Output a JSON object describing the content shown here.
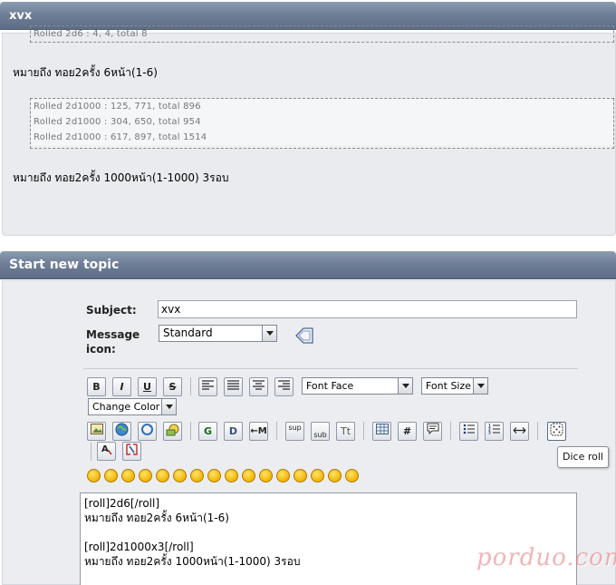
{
  "post": {
    "title": "xvx",
    "roll1": [
      "Rolled 2d6 : 4, 4, total 8"
    ],
    "line1": "หมายถึง ทอย2ครั้ง 6หน้า(1-6)",
    "roll2": [
      "Rolled 2d1000 : 125, 771, total 896",
      "Rolled 2d1000 : 304, 650, total 954",
      "Rolled 2d1000 : 617, 897, total 1514"
    ],
    "line2": "หมายถึง ทอย2ครั้ง 1000หน้า(1-1000) 3รอบ"
  },
  "form": {
    "title": "Start new topic",
    "subject_label": "Subject:",
    "subject_value": "xvx",
    "icon_label": "Message icon:",
    "icon_value": "Standard",
    "font_face": "Font Face",
    "font_size": "Font Size",
    "font_color": "Change Color",
    "tooltip": "Dice roll",
    "message": "[roll]2d6[/roll]\nหมายถึง ทอย2ครั้ง 6หน้า(1-6)\n\n[roll]2d1000x3[/roll]\nหมายถึง ทอย2ครั้ง 1000หน้า(1-1000) 3รอบ"
  },
  "toolbar": {
    "row1": [
      "bold-icon",
      "italic-icon",
      "underline-icon",
      "strikethrough-icon",
      "align-left-icon",
      "align-justify-icon",
      "align-center-icon",
      "align-right-icon"
    ],
    "row2": [
      "image-icon",
      "globe-link-icon",
      "flash-icon",
      "email-icon",
      "google-icon",
      "d-icon",
      "move-icon",
      "superscript-icon",
      "subscript-icon",
      "teletype-icon",
      "table-icon",
      "hash-icon",
      "quote-icon",
      "bullet-list-icon",
      "numbered-list-icon",
      "horizontal-rule-icon",
      "dice-icon",
      "font-color-icon",
      "remove-format-icon"
    ],
    "labels": {
      "bold": "B",
      "italic": "I",
      "underline": "U",
      "strike": "S",
      "google": "G",
      "d": "D",
      "move": "←M",
      "sup": "sup",
      "sub": "sub",
      "tt": "Tt",
      "hash": "#"
    }
  },
  "watermark": "porduo.com",
  "colors": {
    "title_bar": "#6f7f97",
    "post_bg": "#e9ebef",
    "watermark": "#e07878"
  }
}
